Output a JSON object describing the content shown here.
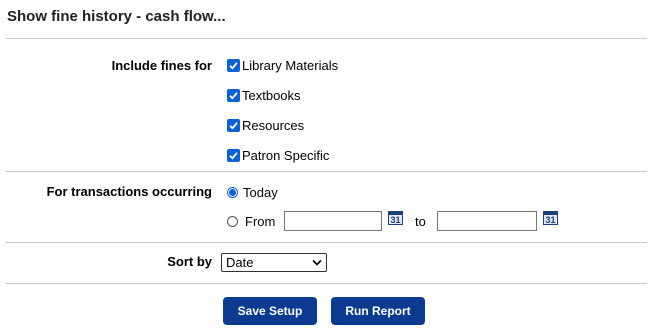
{
  "title": "Show fine history - cash flow...",
  "include": {
    "label": "Include fines for",
    "options": [
      {
        "label": "Library Materials",
        "checked": true
      },
      {
        "label": "Textbooks",
        "checked": true
      },
      {
        "label": "Resources",
        "checked": true
      },
      {
        "label": "Patron Specific",
        "checked": true
      }
    ]
  },
  "transactions": {
    "label": "For transactions occurring",
    "today_label": "Today",
    "from_label": "From",
    "to_label": "to",
    "selected": "Today",
    "from_value": "",
    "to_value": "",
    "calendar_day": "31"
  },
  "sort": {
    "label": "Sort by",
    "selected": "Date"
  },
  "buttons": {
    "save": "Save Setup",
    "run": "Run Report"
  },
  "colors": {
    "accent": "#0b61d6",
    "button": "#0a3b91"
  }
}
